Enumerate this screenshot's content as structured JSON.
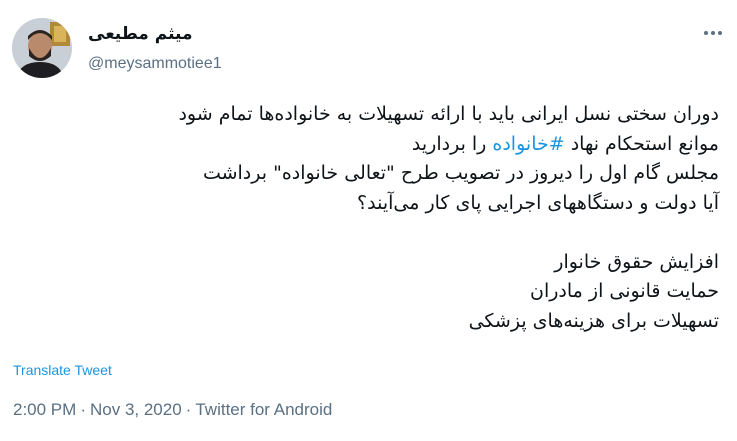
{
  "author": {
    "display_name": "میثم مطیعی",
    "handle": "@meysammotiee1",
    "avatar_icon": "profile-photo"
  },
  "more_icon": "more-horizontal-icon",
  "tweet": {
    "lines": {
      "l1": "دوران سختی نسل ایرانی باید با ارائه تسهیلات به خانواده‌ها تمام شود",
      "l2_prefix": "موانع استحکام نهاد ",
      "l2_hashtag": "#خانواده",
      "l2_suffix": " را بردارید",
      "l3": "مجلس گام اول را دیروز در تصویب طرح \"تعالی خانواده\" برداشت",
      "l4": "آیا دولت و دستگاههای اجرایی پای کار می‌آیند؟",
      "l5": "افزایش حقوق خانوار",
      "l6": "حمایت قانونی از مادران",
      "l7": "تسهیلات برای هزینه‌های پزشکی"
    },
    "translate_label": "Translate Tweet"
  },
  "meta": {
    "time": "2:00 PM",
    "separator": "·",
    "date": "Nov 3, 2020",
    "source": "Twitter for Android"
  },
  "colors": {
    "link": "#1b95e0",
    "muted": "#5b7083",
    "text": "#0f1419"
  }
}
